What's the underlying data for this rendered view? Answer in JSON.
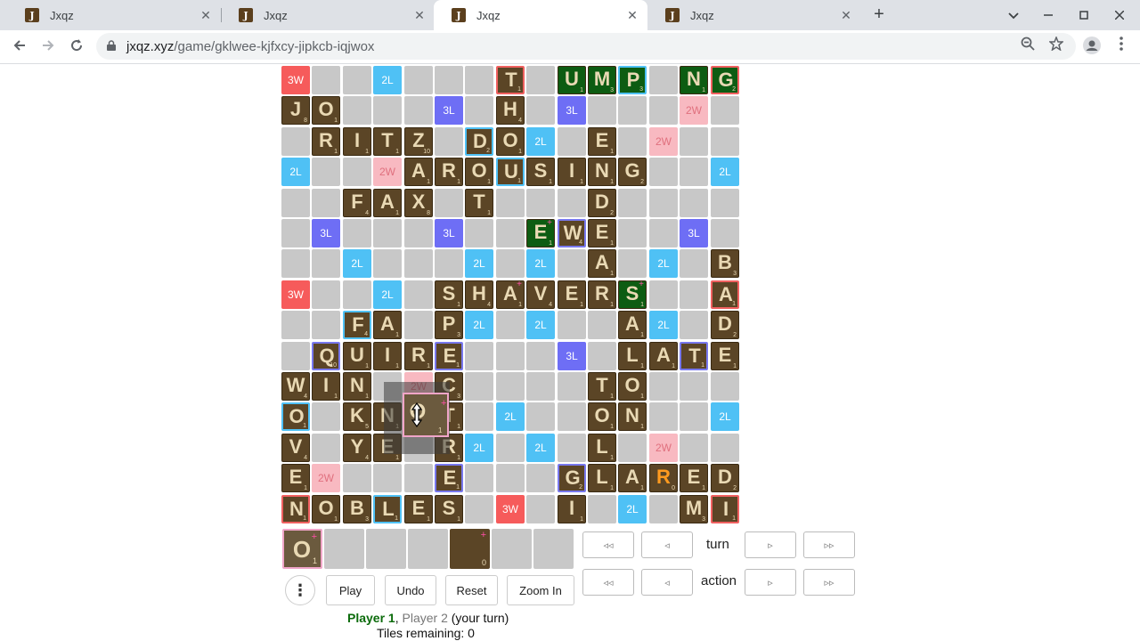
{
  "browser": {
    "tabs": [
      {
        "favicon": "J",
        "title": "Jxqz",
        "close": "✕"
      },
      {
        "favicon": "J",
        "title": "Jxqz",
        "close": "✕"
      },
      {
        "favicon": "J",
        "title": "Jxqz",
        "close": "✕",
        "active": true
      },
      {
        "favicon": "J",
        "title": "Jxqz",
        "close": "✕"
      }
    ],
    "new_tab": "+",
    "url_host": "jxqz.xyz",
    "url_path": "/game/gklwee-kjfxcy-jipkcb-iqjwox",
    "icons": [
      "back-icon",
      "forward-icon",
      "reload-icon",
      "lock-icon",
      "zoom-icon",
      "star-icon",
      "profile-icon",
      "kebab-menu-icon"
    ]
  },
  "board": {
    "rows": [
      [
        [
          "3W"
        ],
        [
          ""
        ],
        [
          ""
        ],
        [
          "2L"
        ],
        [
          ""
        ],
        [
          ""
        ],
        [
          ""
        ],
        [
          "T",
          1,
          "tw"
        ],
        [
          ""
        ],
        [
          "U",
          1,
          "g"
        ],
        [
          "M",
          3,
          "g"
        ],
        [
          "P",
          3,
          "g",
          "dl"
        ],
        [
          ""
        ],
        [
          "N",
          1,
          "g"
        ],
        [
          "G",
          2,
          "g",
          "tw"
        ]
      ],
      [
        [
          "J",
          8
        ],
        [
          "O",
          1
        ],
        [
          ""
        ],
        [
          ""
        ],
        [
          ""
        ],
        [
          "3L"
        ],
        [
          ""
        ],
        [
          "H",
          4
        ],
        [
          ""
        ],
        [
          "3L"
        ],
        [
          ""
        ],
        [
          ""
        ],
        [
          ""
        ],
        [
          "2W"
        ],
        [
          ""
        ]
      ],
      [
        [
          ""
        ],
        [
          "R",
          1
        ],
        [
          "I",
          1
        ],
        [
          "T",
          1
        ],
        [
          "Z",
          10
        ],
        [
          ""
        ],
        [
          "D",
          2,
          "",
          "dl"
        ],
        [
          "O",
          1
        ],
        [
          "2L"
        ],
        [
          ""
        ],
        [
          "E",
          1
        ],
        [
          ""
        ],
        [
          "2W"
        ],
        [
          ""
        ],
        [
          ""
        ]
      ],
      [
        [
          "2L"
        ],
        [
          ""
        ],
        [
          ""
        ],
        [
          "2W"
        ],
        [
          "A",
          1
        ],
        [
          "R",
          1
        ],
        [
          "O",
          1
        ],
        [
          "U",
          1,
          "",
          "dl"
        ],
        [
          "S",
          1
        ],
        [
          "I",
          1
        ],
        [
          "N",
          1
        ],
        [
          "G",
          2
        ],
        [
          ""
        ],
        [
          ""
        ],
        [
          "2L"
        ]
      ],
      [
        [
          ""
        ],
        [
          ""
        ],
        [
          "F",
          4
        ],
        [
          "A",
          1
        ],
        [
          "X",
          8
        ],
        [
          ""
        ],
        [
          "T",
          1
        ],
        [
          ""
        ],
        [
          ""
        ],
        [
          ""
        ],
        [
          "D",
          2
        ],
        [
          ""
        ],
        [
          ""
        ],
        [
          ""
        ],
        [
          ""
        ]
      ],
      [
        [
          ""
        ],
        [
          "3L"
        ],
        [
          ""
        ],
        [
          ""
        ],
        [
          ""
        ],
        [
          "3L"
        ],
        [
          ""
        ],
        [
          ""
        ],
        [
          "E",
          1,
          "g",
          "+"
        ],
        [
          "W",
          4,
          "",
          "tl"
        ],
        [
          "E",
          1
        ],
        [
          ""
        ],
        [
          ""
        ],
        [
          "3L"
        ],
        [
          ""
        ]
      ],
      [
        [
          ""
        ],
        [
          ""
        ],
        [
          "2L"
        ],
        [
          ""
        ],
        [
          ""
        ],
        [
          ""
        ],
        [
          "2L"
        ],
        [
          ""
        ],
        [
          "2L"
        ],
        [
          ""
        ],
        [
          "A",
          1
        ],
        [
          ""
        ],
        [
          "2L"
        ],
        [
          ""
        ],
        [
          "B",
          3
        ]
      ],
      [
        [
          "3W"
        ],
        [
          ""
        ],
        [
          ""
        ],
        [
          "2L"
        ],
        [
          ""
        ],
        [
          "S",
          1
        ],
        [
          "H",
          4
        ],
        [
          "A",
          1,
          "",
          "+"
        ],
        [
          "V",
          4
        ],
        [
          "E",
          1
        ],
        [
          "R",
          1
        ],
        [
          "S",
          1,
          "g",
          "+"
        ],
        [
          ""
        ],
        [
          ""
        ],
        [
          "A",
          1,
          "",
          "tw"
        ]
      ],
      [
        [
          ""
        ],
        [
          ""
        ],
        [
          "F",
          4,
          "",
          "dl"
        ],
        [
          "A",
          1
        ],
        [
          ""
        ],
        [
          "P",
          3
        ],
        [
          "2L"
        ],
        [
          ""
        ],
        [
          "2L"
        ],
        [
          ""
        ],
        [
          ""
        ],
        [
          "A",
          1
        ],
        [
          "2L"
        ],
        [
          ""
        ],
        [
          "D",
          2
        ]
      ],
      [
        [
          ""
        ],
        [
          "Q",
          10,
          "",
          "tl"
        ],
        [
          "U",
          1
        ],
        [
          "I",
          1
        ],
        [
          "R",
          1
        ],
        [
          "E",
          1,
          "",
          "tl"
        ],
        [
          ""
        ],
        [
          ""
        ],
        [
          ""
        ],
        [
          "3L"
        ],
        [
          ""
        ],
        [
          "L",
          1
        ],
        [
          "A",
          1
        ],
        [
          "T",
          1,
          "",
          "tl"
        ],
        [
          "E",
          1
        ]
      ],
      [
        [
          "W",
          4
        ],
        [
          "I",
          1
        ],
        [
          "N",
          1
        ],
        [
          ""
        ],
        [
          "2W"
        ],
        [
          "C",
          3
        ],
        [
          ""
        ],
        [
          ""
        ],
        [
          ""
        ],
        [
          ""
        ],
        [
          "T",
          1
        ],
        [
          "O",
          1
        ],
        [
          ""
        ],
        [
          ""
        ],
        [
          ""
        ]
      ],
      [
        [
          "O",
          1,
          "",
          "dl"
        ],
        [
          ""
        ],
        [
          "K",
          5
        ],
        [
          "N",
          1
        ],
        [
          ""
        ],
        [
          "T",
          1
        ],
        [
          ""
        ],
        [
          "2L"
        ],
        [
          ""
        ],
        [
          ""
        ],
        [
          "O",
          1
        ],
        [
          "N",
          1
        ],
        [
          ""
        ],
        [
          ""
        ],
        [
          "2L"
        ]
      ],
      [
        [
          "V",
          4
        ],
        [
          ""
        ],
        [
          "Y",
          4
        ],
        [
          "E",
          1
        ],
        [
          ""
        ],
        [
          "R",
          1
        ],
        [
          "2L"
        ],
        [
          ""
        ],
        [
          "2L"
        ],
        [
          ""
        ],
        [
          "L",
          1
        ],
        [
          ""
        ],
        [
          "2W"
        ],
        [
          ""
        ],
        [
          ""
        ]
      ],
      [
        [
          "E",
          1
        ],
        [
          "2W"
        ],
        [
          ""
        ],
        [
          ""
        ],
        [
          ""
        ],
        [
          "E",
          1,
          "",
          "tl"
        ],
        [
          ""
        ],
        [
          ""
        ],
        [
          ""
        ],
        [
          "G",
          2,
          "",
          "tl"
        ],
        [
          "L",
          1
        ],
        [
          "A",
          1
        ],
        [
          "R",
          0,
          "blank"
        ],
        [
          "E",
          1
        ],
        [
          "D",
          2
        ]
      ],
      [
        [
          "N",
          1,
          "",
          "tw"
        ],
        [
          "O",
          1
        ],
        [
          "B",
          3
        ],
        [
          "L",
          1,
          "",
          "dl"
        ],
        [
          "E",
          1
        ],
        [
          "S",
          1
        ],
        [
          ""
        ],
        [
          "3W"
        ],
        [
          ""
        ],
        [
          "I",
          1
        ],
        [
          ""
        ],
        [
          "2L"
        ],
        [
          ""
        ],
        [
          "M",
          3
        ],
        [
          "I",
          1,
          "",
          "tw"
        ]
      ]
    ]
  },
  "drag": {
    "letter": "O",
    "points": "1",
    "plus": "+"
  },
  "rack": [
    {
      "letter": "O",
      "points": "1",
      "plus": "+",
      "selected": true
    },
    {
      "letter": "",
      "points": ""
    },
    {
      "letter": "",
      "points": ""
    },
    {
      "letter": "",
      "points": ""
    },
    {
      "letter": "",
      "points": "0",
      "plus": "+",
      "tile": true
    },
    {
      "letter": "",
      "points": ""
    },
    {
      "letter": "",
      "points": ""
    }
  ],
  "controls": {
    "menu": "⋮",
    "play": "Play",
    "undo": "Undo",
    "reset": "Reset",
    "zoom_in": "Zoom In"
  },
  "history_nav": {
    "first": "◃◃",
    "prev": "◃",
    "next": "▹",
    "last": "▹▹",
    "turn_label": "turn",
    "action_label": "action"
  },
  "status": {
    "player1": "Player 1",
    "separator": ", ",
    "player2": "Player 2",
    "turn_note": " (your turn)",
    "tiles_remaining": "Tiles remaining: 0"
  }
}
